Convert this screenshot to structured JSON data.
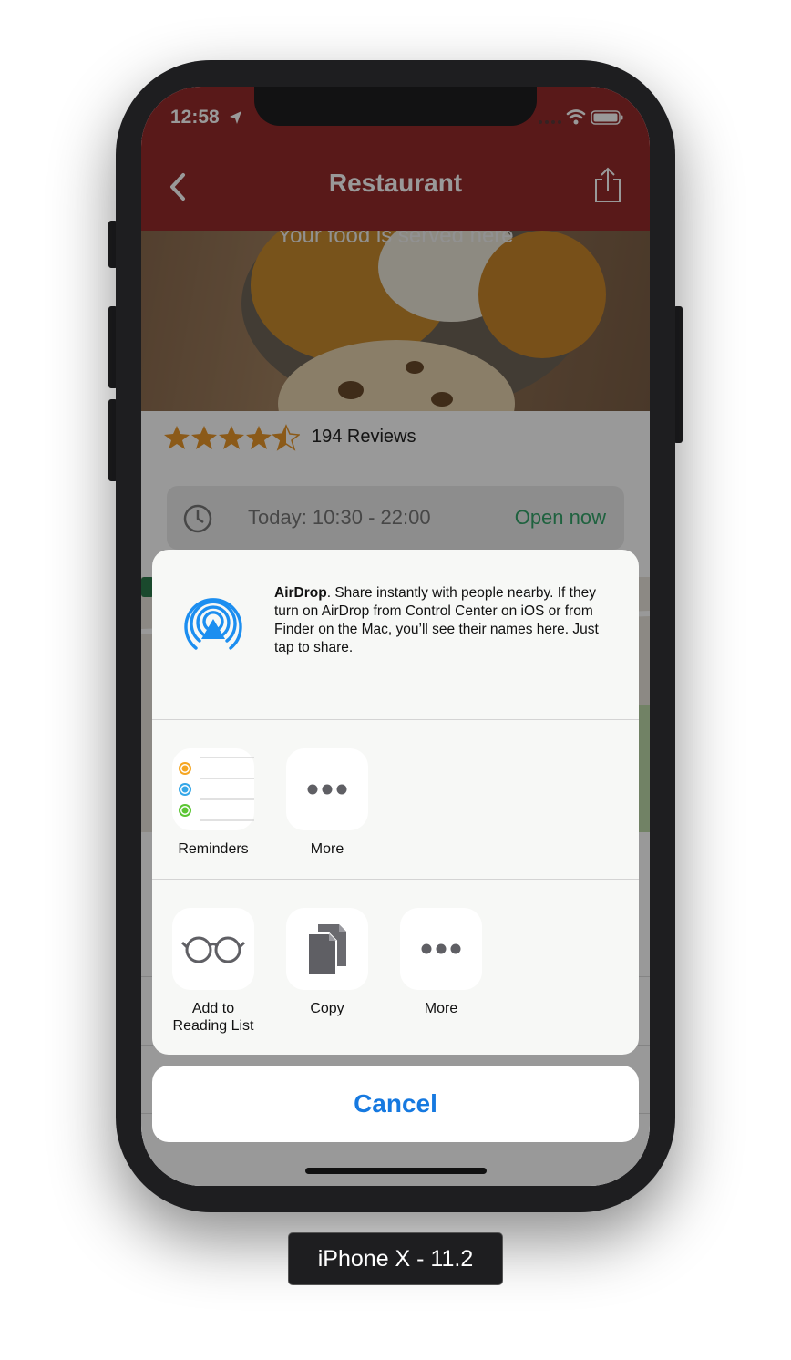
{
  "status_bar": {
    "time": "12:58"
  },
  "nav": {
    "title": "Restaurant"
  },
  "hero": {
    "caption": "Your food is served here"
  },
  "rating": {
    "stars": 4.5,
    "max": 5,
    "reviews_label": "194 Reviews"
  },
  "hours": {
    "text": "Today: 10:30 - 22:00",
    "status": "Open now"
  },
  "share_sheet": {
    "airdrop_title": "AirDrop",
    "airdrop_description": ". Share instantly with people nearby. If they turn on AirDrop from Control Center on iOS or from Finder on the Mac, you’ll see their names here. Just tap to share.",
    "apps": [
      {
        "label": "Reminders",
        "icon": "reminders-icon"
      },
      {
        "label": "More",
        "icon": "more-icon"
      }
    ],
    "actions": [
      {
        "label_line1": "Add to",
        "label_line2": "Reading List",
        "icon": "glasses-icon"
      },
      {
        "label": "Copy",
        "icon": "copy-icon"
      },
      {
        "label": "More",
        "icon": "more-icon"
      }
    ],
    "cancel_label": "Cancel"
  },
  "device_label": "iPhone X - 11.2",
  "colors": {
    "nav_bar": "#952a2b",
    "star": "#e8962a",
    "open_status": "#34a36a",
    "airdrop_blue": "#1c8ef0",
    "cancel_text": "#1679e0",
    "reminder_dots": [
      "#f5a623",
      "#35a7e8",
      "#5cc634"
    ]
  }
}
